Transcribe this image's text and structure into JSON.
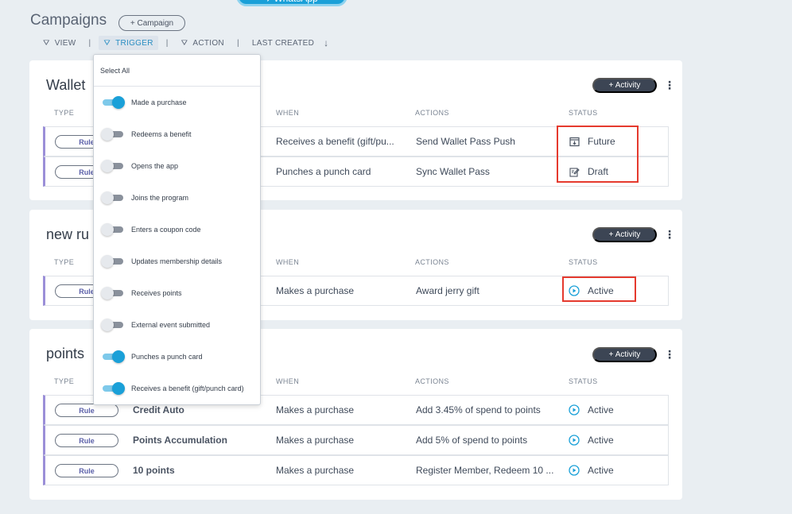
{
  "top_pill": "↗WhatsApp",
  "page_title": "Campaigns",
  "add_campaign_label": "+ Campaign",
  "filters": {
    "view": "VIEW",
    "trigger": "TRIGGER",
    "action": "ACTION",
    "last_created": "LAST CREATED"
  },
  "columns": {
    "type": "TYPE",
    "when": "WHEN",
    "actions": "ACTIONS",
    "status": "STATUS"
  },
  "activity_label": "+ Activity",
  "dropdown": {
    "select_all": "Select All",
    "items": [
      {
        "label": "Made a purchase",
        "on": true
      },
      {
        "label": "Redeems a benefit",
        "on": false
      },
      {
        "label": "Opens the app",
        "on": false
      },
      {
        "label": "Joins the program",
        "on": false
      },
      {
        "label": "Enters a coupon code",
        "on": false
      },
      {
        "label": "Updates membership details",
        "on": false
      },
      {
        "label": "Receives points",
        "on": false
      },
      {
        "label": "External event submitted",
        "on": false
      },
      {
        "label": "Punches a punch card",
        "on": true
      },
      {
        "label": "Receives a benefit (gift/punch card)",
        "on": true
      }
    ]
  },
  "cards": [
    {
      "title": "Wallet",
      "rows": [
        {
          "type": "Rule",
          "name": "",
          "when": "Receives a benefit (gift/pu...",
          "actions": "Send Wallet Pass Push",
          "status": "Future",
          "status_icon": "calendar-icon"
        },
        {
          "type": "Rule",
          "name": "",
          "when": "Punches a punch card",
          "actions": "Sync Wallet Pass",
          "status": "Draft",
          "status_icon": "edit-icon"
        }
      ]
    },
    {
      "title": "new ru",
      "rows": [
        {
          "type": "Rule",
          "name": "",
          "when": "Makes a purchase",
          "actions": "Award jerry gift",
          "status": "Active",
          "status_icon": "play-icon"
        }
      ]
    },
    {
      "title": "points",
      "rows": [
        {
          "type": "Rule",
          "name": "Credit Auto",
          "when": "Makes a purchase",
          "actions": "Add 3.45% of spend to points",
          "status": "Active",
          "status_icon": "play-icon"
        },
        {
          "type": "Rule",
          "name": "Points Accumulation",
          "when": "Makes a purchase",
          "actions": "Add 5% of spend to points",
          "status": "Active",
          "status_icon": "play-icon"
        },
        {
          "type": "Rule",
          "name": "10 points",
          "when": "Makes a purchase",
          "actions": "Register Member, Redeem 10 ...",
          "status": "Active",
          "status_icon": "play-icon"
        }
      ]
    }
  ],
  "colors": {
    "accent": "#1aa0d8",
    "highlight": "#e53a2e",
    "rule_bar": "#9b8fd8"
  }
}
